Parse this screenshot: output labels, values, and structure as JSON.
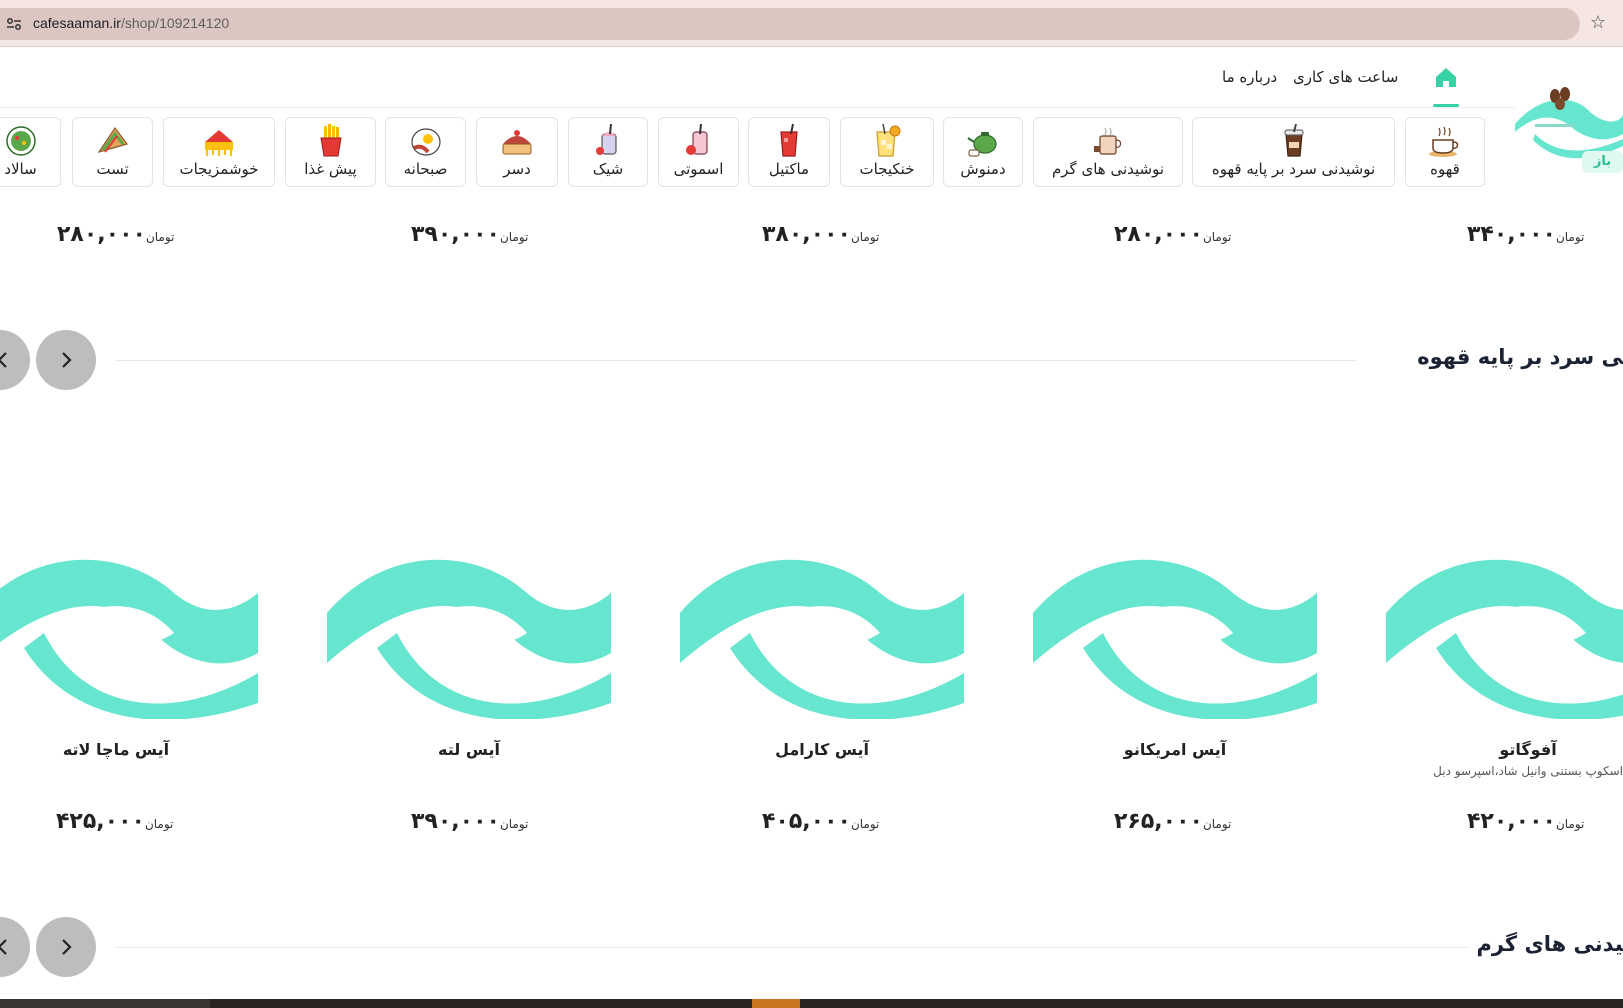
{
  "browser": {
    "url_host": "cafesaaman.ir",
    "url_path": "/shop/109214120"
  },
  "header": {
    "open_badge": "باز",
    "nav": {
      "working_hours": "ساعت های کاری",
      "about": "درباره ما"
    }
  },
  "categories": [
    {
      "label": "قهوه",
      "icon": "coffee-cup-icon"
    },
    {
      "label": "نوشیدنی سرد بر پایه قهوه",
      "icon": "iced-coffee-icon"
    },
    {
      "label": "نوشیدنی های گرم",
      "icon": "hot-drink-icon"
    },
    {
      "label": "دمنوش",
      "icon": "teapot-icon"
    },
    {
      "label": "خنکیجات",
      "icon": "cold-drink-icon"
    },
    {
      "label": "ماکتیل",
      "icon": "mocktail-icon"
    },
    {
      "label": "اسموتی",
      "icon": "smoothie-icon"
    },
    {
      "label": "شیک",
      "icon": "shake-icon"
    },
    {
      "label": "دسر",
      "icon": "dessert-icon"
    },
    {
      "label": "صبحانه",
      "icon": "breakfast-icon"
    },
    {
      "label": "پیش غذا",
      "icon": "fries-icon"
    },
    {
      "label": "خوشمزیجات",
      "icon": "treats-icon"
    },
    {
      "label": "تست",
      "icon": "toast-icon"
    },
    {
      "label": "سالاد",
      "icon": "salad-icon"
    }
  ],
  "currency": "تومان",
  "top_prices": [
    "۳۴۰,۰۰۰",
    "۲۸۰,۰۰۰",
    "۳۸۰,۰۰۰",
    "۳۹۰,۰۰۰",
    "۲۸۰,۰۰۰"
  ],
  "sections": {
    "cold_coffee": {
      "title": "نوشیدنی سرد بر پایه قهوه",
      "products": [
        {
          "name": "آفوگاتو",
          "desc": "اسکوپ بستنی وانیل شاد،اسپرسو دبل",
          "price": "۴۲۰,۰۰۰"
        },
        {
          "name": "آیس امریکانو",
          "desc": "",
          "price": "۲۶۵,۰۰۰"
        },
        {
          "name": "آیس کارامل",
          "desc": "",
          "price": "۴۰۵,۰۰۰"
        },
        {
          "name": "آیس لته",
          "desc": "",
          "price": "۳۹۰,۰۰۰"
        },
        {
          "name": "آیس ماچا لاته",
          "desc": "",
          "price": "۴۲۵,۰۰۰"
        }
      ]
    },
    "hot_drinks": {
      "title": "نوشیدنی های گرم"
    }
  },
  "colors": {
    "brand": "#66e6cf",
    "accent": "#38d0a5",
    "coffee": "#6b3d22"
  }
}
